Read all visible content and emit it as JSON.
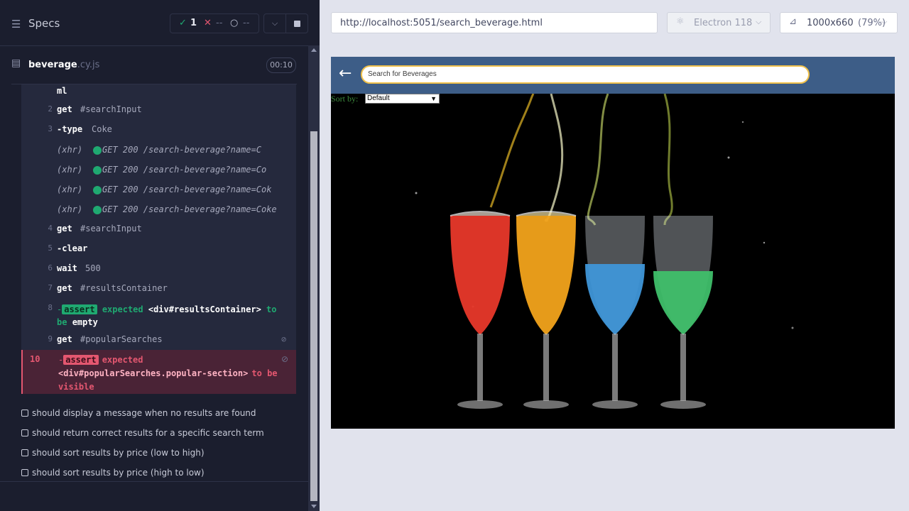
{
  "runner": {
    "specs_label": "Specs",
    "stats": {
      "passed": "1",
      "failed": "--",
      "pending": "--"
    },
    "spec_file": {
      "name": "beverage",
      "ext": ".cy.js",
      "duration": "00:10"
    }
  },
  "commands": {
    "truncated": "ml",
    "c2": {
      "num": "2",
      "name": "get",
      "msg": "#searchInput"
    },
    "c3": {
      "num": "3",
      "name": "-type",
      "msg": "Coke"
    },
    "x1": {
      "name": "(xhr)",
      "msg": "GET 200 /search-beverage?name=C"
    },
    "x2": {
      "name": "(xhr)",
      "msg": "GET 200 /search-beverage?name=Co"
    },
    "x3": {
      "name": "(xhr)",
      "msg": "GET 200 /search-beverage?name=Cok"
    },
    "x4": {
      "name": "(xhr)",
      "msg": "GET 200 /search-beverage?name=Coke"
    },
    "c4": {
      "num": "4",
      "name": "get",
      "msg": "#searchInput"
    },
    "c5": {
      "num": "5",
      "name": "-clear"
    },
    "c6": {
      "num": "6",
      "name": "wait",
      "msg": "500"
    },
    "c7": {
      "num": "7",
      "name": "get",
      "msg": "#resultsContainer"
    },
    "c8": {
      "num": "8",
      "dash": "-",
      "badge": "assert",
      "expected": "expected",
      "element": "<div#resultsContainer>",
      "to": "to",
      "be": "be",
      "rest": "empty"
    },
    "c9": {
      "num": "9",
      "name": "get",
      "msg": "#popularSearches"
    },
    "c10": {
      "num": "10",
      "dash": "-",
      "badge": "assert",
      "expected": "expected",
      "element": "<div#popularSearches.popular-section>",
      "to": "to be",
      "rest": "visible"
    }
  },
  "tests": [
    "should display a message when no results are found",
    "should return correct results for a specific search term",
    "should sort results by price (low to high)",
    "should sort results by price (high to low)"
  ],
  "toolbar": {
    "url": "http://localhost:5051/search_beverage.html",
    "browser": "Electron 118",
    "viewport": "1000x660",
    "zoom": "(79%)"
  },
  "app": {
    "back_arrow": "←",
    "search_placeholder": "Search for Beverages",
    "sort_label": "Sort by:",
    "sort_value": "Default"
  },
  "icons": {
    "specs": "specs-list-icon",
    "file": "file-icon",
    "browser": "electron-icon",
    "viewport": "viewport-icon",
    "eye": "eye-slash-icon"
  },
  "colors": {
    "pass": "#1fa971",
    "fail": "#e45770",
    "app_header": "#3d5d87",
    "search_border": "#f0c04a"
  }
}
